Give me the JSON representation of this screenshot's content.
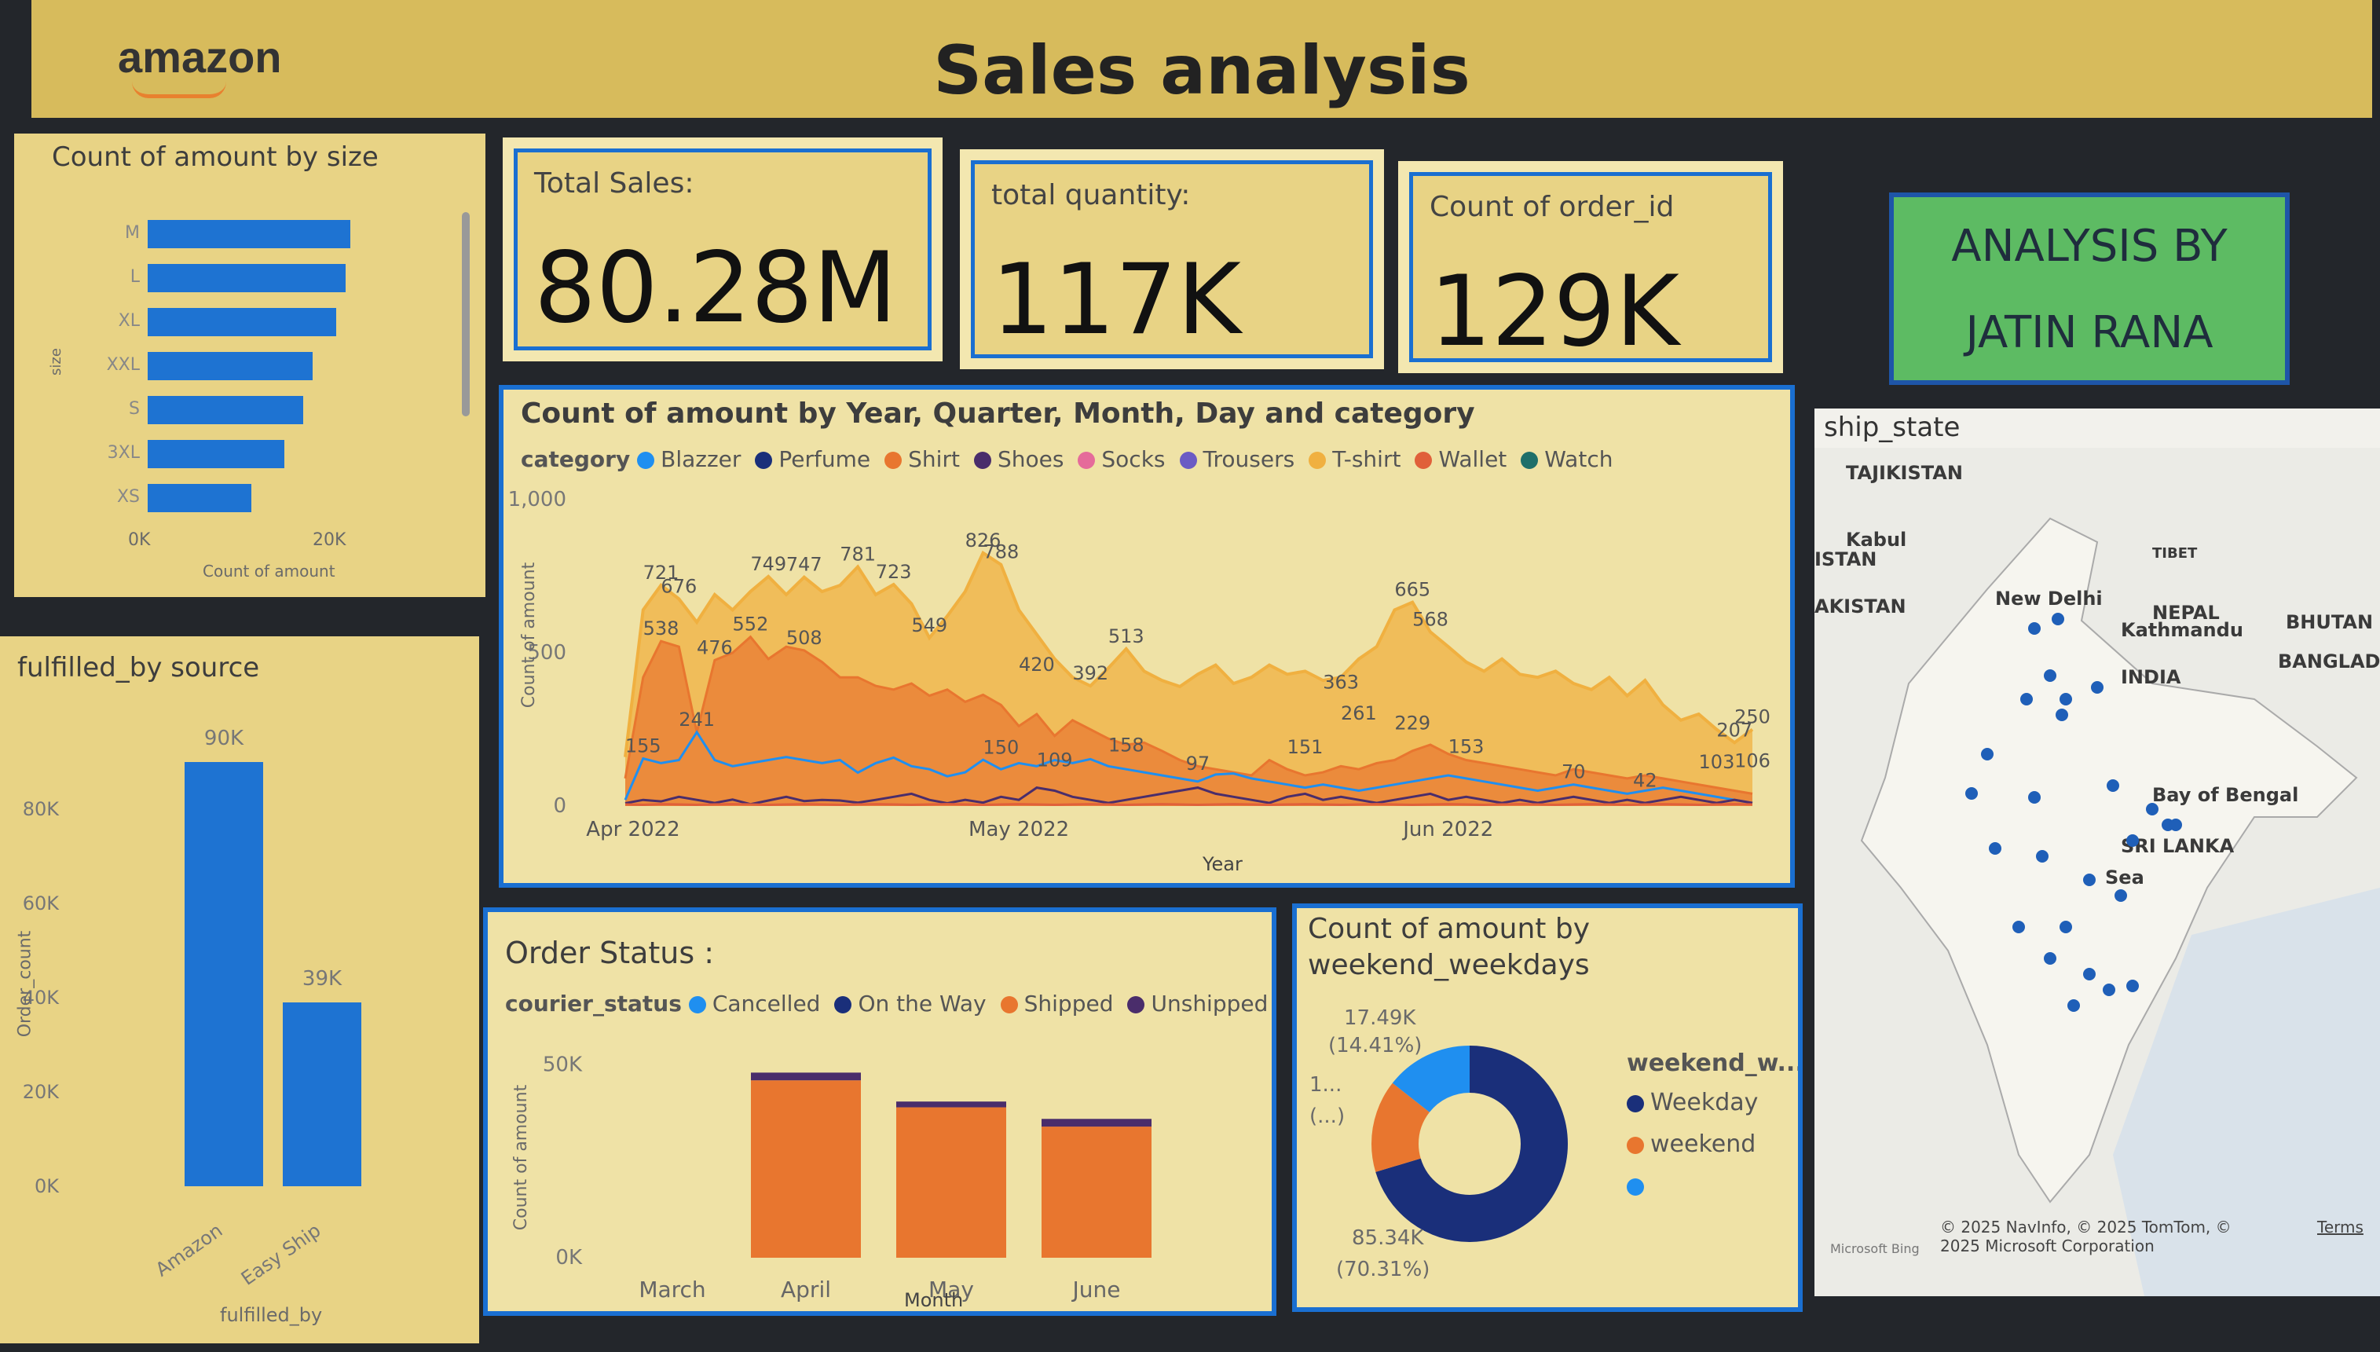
{
  "header": {
    "logo": "amazon",
    "title": "Sales analysis"
  },
  "size_panel": {
    "title": "Count of amount by size",
    "axis_label_y": "size",
    "axis_label_x": "Count of amount",
    "ticks_x": [
      "0K",
      "20K"
    ],
    "chart_data": {
      "type": "bar",
      "orientation": "horizontal",
      "categories": [
        "M",
        "L",
        "XL",
        "XXL",
        "S",
        "3XL",
        "XS"
      ],
      "values": [
        21500,
        21000,
        20000,
        17500,
        16500,
        14500,
        11000
      ],
      "xlim": [
        0,
        25000
      ],
      "color": "#1e73d2"
    }
  },
  "fulfilled_panel": {
    "title": "fulfilled_by source",
    "axis_label_y": "Order_count",
    "axis_label_x": "fulfilled_by",
    "ticks_y": [
      "0K",
      "20K",
      "40K",
      "60K",
      "80K"
    ],
    "chart_data": {
      "type": "bar",
      "categories": [
        "Amazon",
        "Easy Ship"
      ],
      "values": [
        90000,
        39000
      ],
      "data_labels": [
        "90K",
        "39K"
      ],
      "ylim": [
        0,
        100000
      ],
      "color": "#1e73d2"
    }
  },
  "kpis": [
    {
      "label": "Total Sales:",
      "value": "80.28M"
    },
    {
      "label": "total quantity:",
      "value": "117K"
    },
    {
      "label": "Count of order_id",
      "value": "129K"
    }
  ],
  "analysis_card": {
    "line1": "ANALYSIS BY",
    "line2": "JATIN RANA",
    "color": "#5dbb63"
  },
  "trend_panel": {
    "title": "Count of amount by Year, Quarter, Month, Day and category",
    "legend_title": "category",
    "legend": [
      {
        "name": "Blazzer",
        "color": "#1f8ff0"
      },
      {
        "name": "Perfume",
        "color": "#1a2f7a"
      },
      {
        "name": "Shirt",
        "color": "#e8762f"
      },
      {
        "name": "Shoes",
        "color": "#4a2d6b"
      },
      {
        "name": "Socks",
        "color": "#e56b9a"
      },
      {
        "name": "Trousers",
        "color": "#6b5bc4"
      },
      {
        "name": "T-shirt",
        "color": "#f0b040"
      },
      {
        "name": "Wallet",
        "color": "#e0603a"
      },
      {
        "name": "Watch",
        "color": "#1f6f6a"
      }
    ],
    "y_label": "Count of amount",
    "x_label": "Year",
    "y_ticks": [
      "0",
      "500",
      "1,000"
    ],
    "x_ticks": [
      "Apr 2022",
      "May 2022",
      "Jun 2022"
    ],
    "chart_data": {
      "type": "area",
      "ylim": [
        0,
        1000
      ],
      "days": 91,
      "series": [
        {
          "name": "T-shirt",
          "values": [
            160,
            640,
            721,
            676,
            600,
            690,
            640,
            700,
            749,
            690,
            747,
            700,
            720,
            781,
            690,
            723,
            660,
            549,
            620,
            700,
            826,
            788,
            640,
            560,
            480,
            420,
            392,
            450,
            513,
            440,
            410,
            390,
            430,
            460,
            400,
            420,
            460,
            430,
            440,
            410,
            420,
            480,
            520,
            640,
            665,
            568,
            520,
            470,
            440,
            480,
            430,
            420,
            440,
            400,
            380,
            420,
            360,
            410,
            330,
            280,
            300,
            250,
            207,
            250
          ]
        },
        {
          "name": "Shirt",
          "values": [
            90,
            420,
            538,
            520,
            241,
            476,
            500,
            552,
            480,
            520,
            508,
            470,
            420,
            420,
            392,
            380,
            400,
            360,
            380,
            340,
            363,
            330,
            261,
            300,
            229,
            280,
            250,
            220,
            200,
            207,
            180,
            150,
            130,
            120,
            110,
            100,
            150,
            120,
            100,
            110,
            130,
            120,
            140,
            150,
            180,
            200,
            170,
            150,
            140,
            130,
            120,
            110,
            100,
            120,
            110,
            100,
            90,
            100,
            90,
            80,
            70,
            60,
            50,
            40
          ]
        },
        {
          "name": "Blazzer",
          "values": [
            20,
            155,
            140,
            150,
            241,
            150,
            130,
            140,
            150,
            160,
            150,
            140,
            150,
            109,
            140,
            158,
            130,
            120,
            97,
            110,
            151,
            120,
            140,
            130,
            150,
            140,
            153,
            130,
            120,
            110,
            100,
            90,
            80,
            103,
            106,
            90,
            80,
            70,
            60,
            70,
            60,
            50,
            60,
            70,
            80,
            90,
            100,
            90,
            80,
            70,
            60,
            50,
            60,
            70,
            60,
            50,
            40,
            50,
            60,
            50,
            40,
            30,
            20,
            10
          ]
        },
        {
          "name": "Shoes",
          "values": [
            9,
            20,
            15,
            30,
            20,
            10,
            21,
            6,
            18,
            30,
            16,
            20,
            18,
            11,
            20,
            30,
            40,
            20,
            9,
            20,
            11,
            30,
            20,
            60,
            50,
            30,
            20,
            10,
            20,
            30,
            40,
            50,
            60,
            40,
            30,
            20,
            10,
            30,
            40,
            20,
            30,
            20,
            10,
            20,
            30,
            40,
            20,
            30,
            20,
            10,
            20,
            10,
            20,
            30,
            20,
            10,
            20,
            10,
            20,
            30,
            20,
            10,
            20,
            10
          ]
        },
        {
          "name": "Wallet",
          "values": [
            5,
            4,
            6,
            5,
            4,
            5,
            6,
            5,
            4,
            5,
            6,
            5,
            4,
            5,
            6,
            5,
            4,
            5,
            6,
            5,
            4,
            5,
            6,
            5,
            4,
            5,
            6,
            5,
            4,
            5,
            6,
            5,
            4,
            5,
            6,
            5,
            4,
            5,
            6,
            5,
            4,
            5,
            6,
            5,
            4,
            5,
            6,
            5,
            4,
            5,
            6,
            5,
            4,
            5,
            6,
            5,
            4,
            5,
            6,
            5,
            4,
            5,
            6,
            5
          ]
        }
      ],
      "data_labels": [
        {
          "v": "721",
          "i": 2,
          "y": 721
        },
        {
          "v": "676",
          "i": 3,
          "y": 676
        },
        {
          "v": "749",
          "i": 8,
          "y": 749
        },
        {
          "v": "747",
          "i": 10,
          "y": 747
        },
        {
          "v": "781",
          "i": 13,
          "y": 781
        },
        {
          "v": "723",
          "i": 15,
          "y": 723
        },
        {
          "v": "549",
          "i": 17,
          "y": 549
        },
        {
          "v": "826",
          "i": 20,
          "y": 826
        },
        {
          "v": "788",
          "i": 21,
          "y": 788
        },
        {
          "v": "513",
          "i": 28,
          "y": 513
        },
        {
          "v": "665",
          "i": 44,
          "y": 665
        },
        {
          "v": "568",
          "i": 45,
          "y": 568
        },
        {
          "v": "538",
          "i": 2,
          "y": 538
        },
        {
          "v": "476",
          "i": 5,
          "y": 476
        },
        {
          "v": "552",
          "i": 7,
          "y": 552
        },
        {
          "v": "508",
          "i": 10,
          "y": 508
        },
        {
          "v": "241",
          "i": 4,
          "y": 241
        },
        {
          "v": "420",
          "i": 23,
          "y": 420
        },
        {
          "v": "392",
          "i": 26,
          "y": 392
        },
        {
          "v": "363",
          "i": 40,
          "y": 363
        },
        {
          "v": "261",
          "i": 41,
          "y": 261
        },
        {
          "v": "229",
          "i": 44,
          "y": 229
        },
        {
          "v": "155",
          "i": 1,
          "y": 155
        },
        {
          "v": "150",
          "i": 21,
          "y": 150
        },
        {
          "v": "109",
          "i": 24,
          "y": 109
        },
        {
          "v": "158",
          "i": 28,
          "y": 158
        },
        {
          "v": "97",
          "i": 32,
          "y": 97
        },
        {
          "v": "151",
          "i": 38,
          "y": 151
        },
        {
          "v": "153",
          "i": 47,
          "y": 153
        },
        {
          "v": "70",
          "i": 53,
          "y": 70
        },
        {
          "v": "207",
          "i": 62,
          "y": 207
        },
        {
          "v": "250",
          "i": 63,
          "y": 250
        },
        {
          "v": "103",
          "i": 61,
          "y": 103
        },
        {
          "v": "106",
          "i": 63,
          "y": 106
        },
        {
          "v": "42",
          "i": 57,
          "y": 42
        }
      ]
    }
  },
  "order_status": {
    "title": "Order Status :",
    "legend_title": "courier_status",
    "legend": [
      {
        "name": "Cancelled",
        "color": "#1f8ff0"
      },
      {
        "name": "On the Way",
        "color": "#1a2f7a"
      },
      {
        "name": "Shipped",
        "color": "#e8762f"
      },
      {
        "name": "Unshipped",
        "color": "#4a2d6b"
      }
    ],
    "y_label": "Count of amount",
    "x_label": "Month",
    "y_ticks": [
      "0K",
      "50K"
    ],
    "chart_data": {
      "type": "bar",
      "stacked": true,
      "categories": [
        "March",
        "April",
        "May",
        "June"
      ],
      "series": [
        {
          "name": "Shipped",
          "values": [
            0,
            46000,
            39000,
            34000
          ]
        },
        {
          "name": "Unshipped",
          "values": [
            0,
            2000,
            1500,
            2000
          ]
        }
      ],
      "ylim": [
        0,
        55000
      ]
    }
  },
  "weekend_panel": {
    "title_line1": "Count of amount by",
    "title_line2": "weekend_weekdays",
    "legend_title": "weekend_w...",
    "legend": [
      {
        "name": "Weekday",
        "color": "#1a2f7a"
      },
      {
        "name": "weekend",
        "color": "#e8762f"
      },
      {
        "name": "",
        "color": "#1f8ff0"
      }
    ],
    "labels": {
      "top": "17.49K",
      "top_pct": "(14.41%)",
      "mid": "1...",
      "mid_pct": "(...)",
      "bottom": "85.34K",
      "bottom_pct": "(70.31%)"
    },
    "chart_data": {
      "type": "pie",
      "donut": true,
      "values": [
        {
          "name": "Weekday",
          "value": 85.34,
          "color": "#1a2f7a"
        },
        {
          "name": "weekend",
          "value": 18.5,
          "color": "#e8762f"
        },
        {
          "name": "",
          "value": 17.49,
          "color": "#1f8ff0"
        }
      ]
    }
  },
  "map_panel": {
    "title": "ship_state",
    "labels": [
      {
        "text": "TAJIKISTAN"
      },
      {
        "text": "Kabul"
      },
      {
        "text": "ISTAN"
      },
      {
        "text": "TIBET"
      },
      {
        "text": "New Delhi"
      },
      {
        "text": "AKISTAN"
      },
      {
        "text": "NEPAL"
      },
      {
        "text": "Kathmandu"
      },
      {
        "text": "BHUTAN"
      },
      {
        "text": "BANGLADESH"
      },
      {
        "text": "INDIA"
      },
      {
        "text": "Bay of Bengal"
      },
      {
        "text": "SRI LANKA"
      },
      {
        "text": "Sea"
      }
    ],
    "copyright": "© 2025 NavInfo, © 2025 TomTom, © 2025 Microsoft Corporation",
    "terms": "Terms",
    "bing": "Microsoft Bing"
  }
}
